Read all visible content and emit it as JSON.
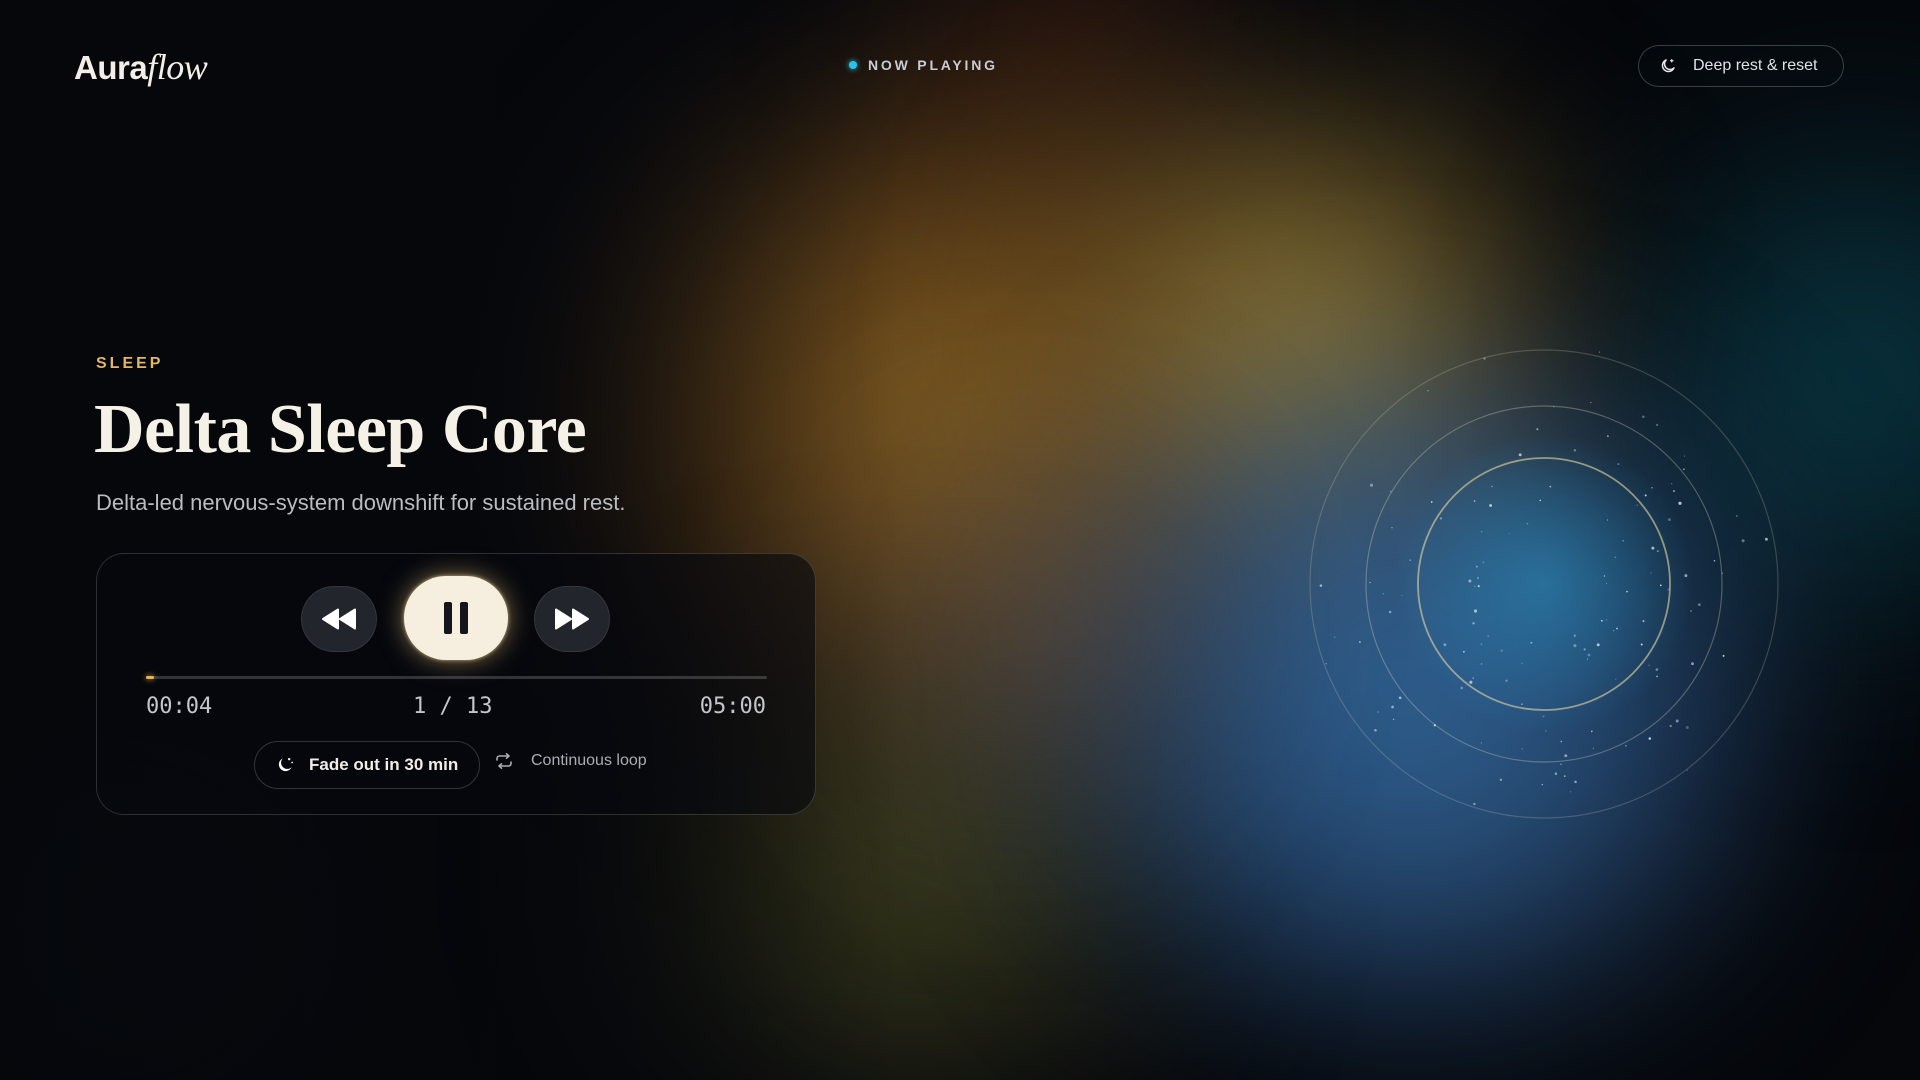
{
  "app": {
    "brand_bold": "Aura",
    "brand_italic": "flow"
  },
  "header": {
    "now_playing_label": "NOW PLAYING",
    "mood_label": "Deep rest & reset",
    "mood_icon": "moon-icon"
  },
  "track": {
    "category": "SLEEP",
    "title": "Delta Sleep Core",
    "description": "Delta-led nervous-system downshift for sustained rest."
  },
  "player": {
    "elapsed": "00:04",
    "position": "1 / 13",
    "duration": "05:00",
    "progress": 0.013,
    "state_icon": "pause-icon",
    "fade_label": "Fade out in 30 min",
    "loop_label": "Continuous loop"
  },
  "colors": {
    "accent": "#e2b567",
    "progress": "#f0b24a",
    "live_dot": "#2bc3e6",
    "play_button": "#f6efe0"
  }
}
